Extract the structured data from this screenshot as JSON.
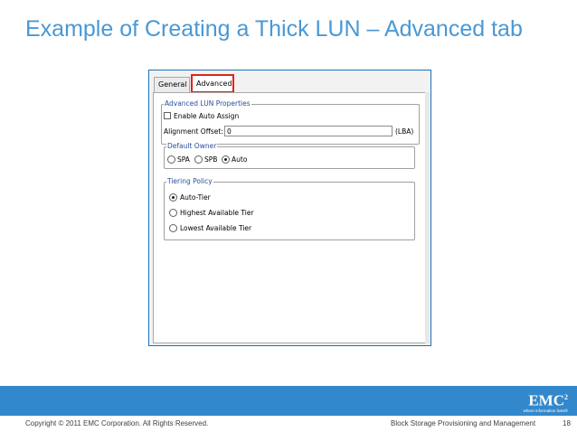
{
  "slide": {
    "title": "Example of Creating a Thick LUN – Advanced tab"
  },
  "dialog": {
    "tabs": [
      {
        "label": "General",
        "selected": false
      },
      {
        "label": "Advanced",
        "selected": true
      }
    ],
    "advanced_lun_properties": {
      "title": "Advanced LUN Properties",
      "enable_auto_assign": {
        "label": "Enable Auto Assign",
        "checked": false
      },
      "alignment_offset": {
        "label": "Alignment Offset:",
        "value": "0",
        "unit": "(LBA)"
      }
    },
    "default_owner": {
      "title": "Default Owner",
      "options": [
        {
          "label": "SPA",
          "selected": false
        },
        {
          "label": "SPB",
          "selected": false
        },
        {
          "label": "Auto",
          "selected": true
        }
      ]
    },
    "tiering_policy": {
      "title": "Tiering Policy",
      "options": [
        {
          "label": "Auto-Tier",
          "selected": true
        },
        {
          "label": "Highest Available Tier",
          "selected": false
        },
        {
          "label": "Lowest Available Tier",
          "selected": false
        }
      ]
    },
    "colors": {
      "highlight_border": "#e0241b",
      "group_title": "#2a4e9c",
      "frame": "#1e6fb8"
    }
  },
  "footer": {
    "logo_text": "EMC",
    "logo_superscript": "2",
    "logo_tagline": "where information lives®",
    "copyright": "Copyright © 2011 EMC Corporation. All Rights Reserved.",
    "deck_title": "Block Storage Provisioning and Management",
    "page_number": "18",
    "bar_color": "#3388cc"
  }
}
